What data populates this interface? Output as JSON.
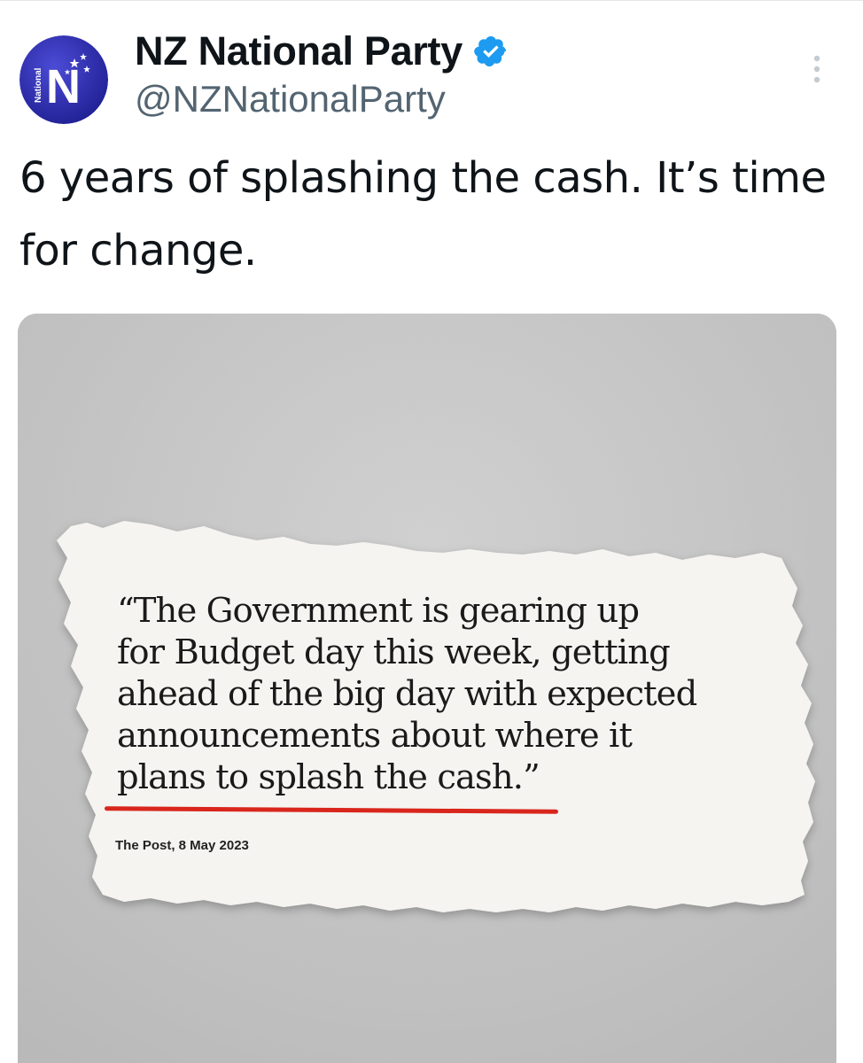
{
  "tweet": {
    "author": {
      "display_name": "NZ National Party",
      "handle": "@NZNationalParty",
      "verified": true,
      "avatar": {
        "logo_letter": "N",
        "logo_side_text": "National",
        "icon": "national-party-logo"
      }
    },
    "text": "6 years of splashing the cash. It’s time for change.",
    "more_icon": "more-vertical-icon",
    "verified_icon": "verified-badge-icon",
    "media": {
      "quote": "“The Government is gearing up\nfor Budget day this week, getting\nahead of the big day with expected\nannouncements about where it\nplans to splash the cash.”",
      "source": "The Post, 8 May 2023"
    }
  },
  "colors": {
    "text_primary": "#0f1419",
    "text_secondary": "#536471",
    "verified_blue": "#1d9bf0",
    "avatar_bg": "#2a2aa6",
    "underline_red": "#d9261c",
    "media_bg": "#c8c8c8"
  }
}
